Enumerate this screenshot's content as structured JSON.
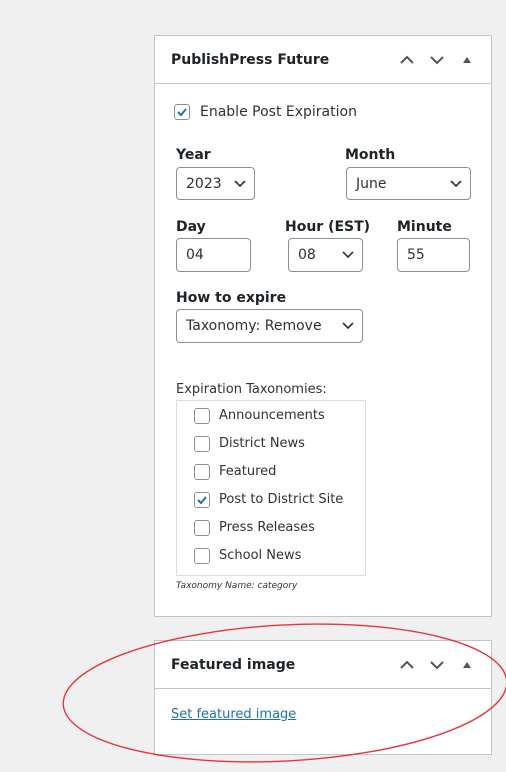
{
  "publishpress_panel": {
    "title": "PublishPress Future",
    "enable_label": "Enable Post Expiration",
    "enable_checked": true,
    "year": {
      "label": "Year",
      "value": "2023"
    },
    "month": {
      "label": "Month",
      "value": "June"
    },
    "day": {
      "label": "Day",
      "value": "04"
    },
    "hour": {
      "label": "Hour (EST)",
      "value": "08"
    },
    "minute": {
      "label": "Minute",
      "value": "55"
    },
    "how_to_expire": {
      "label": "How to expire",
      "value": "Taxonomy: Remove"
    },
    "taxonomies": {
      "label": "Expiration Taxonomies:",
      "items": [
        {
          "label": "Announcements",
          "checked": false
        },
        {
          "label": "District News",
          "checked": false
        },
        {
          "label": "Featured",
          "checked": false
        },
        {
          "label": "Post to District Site",
          "checked": true
        },
        {
          "label": "Press Releases",
          "checked": false
        },
        {
          "label": "School News",
          "checked": false
        }
      ],
      "note": "Taxonomy Name: category"
    }
  },
  "featured_image_panel": {
    "title": "Featured image",
    "set_link": "Set featured image"
  },
  "colors": {
    "accent": "#2271b1",
    "annotation": "#e8353a",
    "border": "#c3c4c7",
    "background": "#f0f0f1"
  },
  "icons": {
    "move_up": "chevron-up-icon",
    "move_down": "chevron-down-icon",
    "toggle": "triangle-up-icon"
  }
}
